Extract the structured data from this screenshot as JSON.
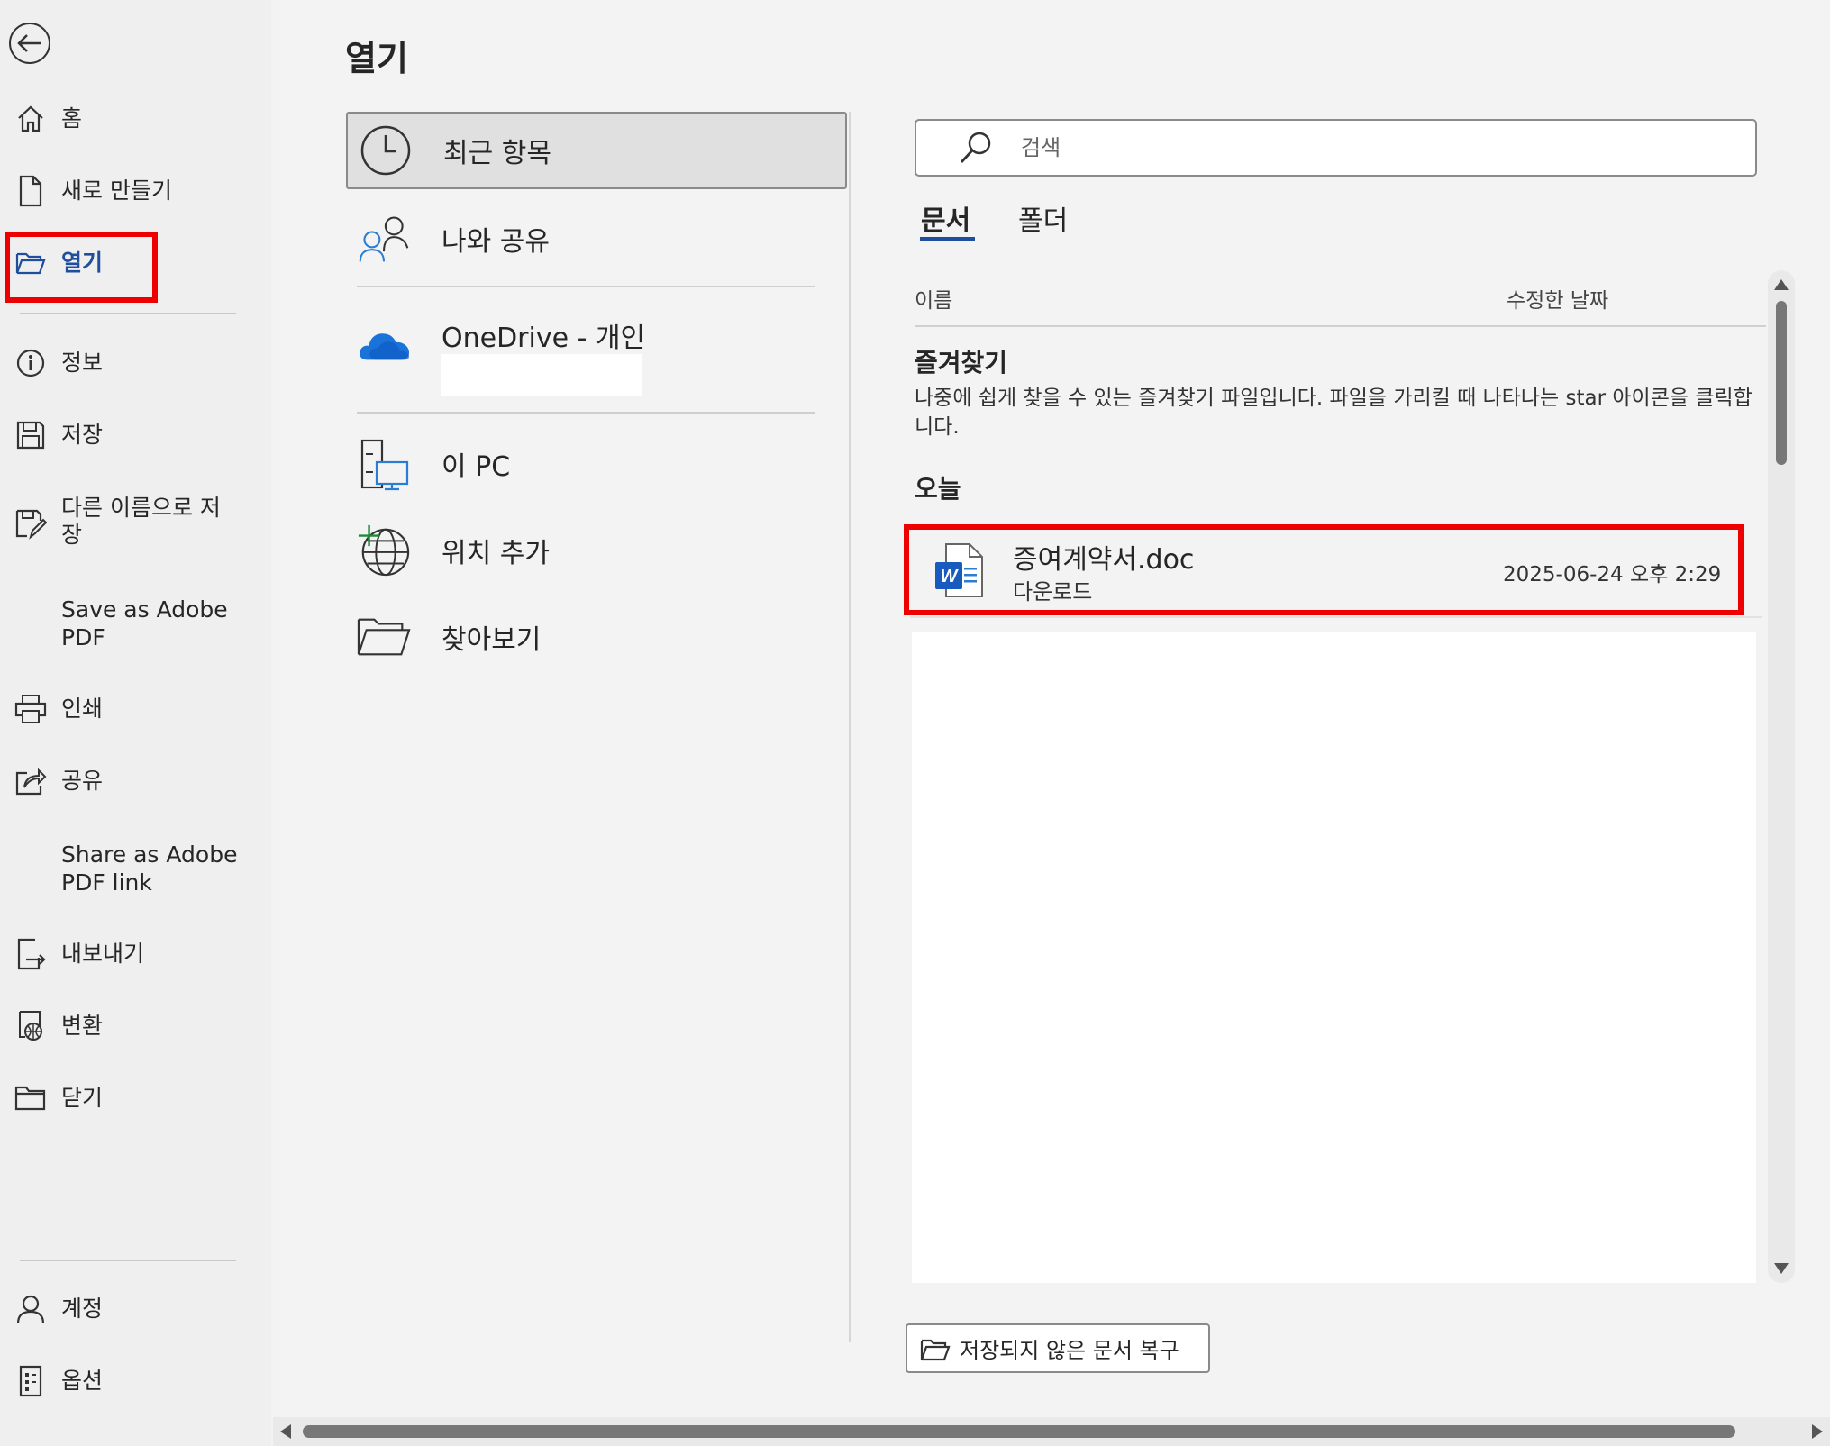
{
  "sidebar": {
    "items": [
      {
        "label": "홈",
        "icon": "home-icon"
      },
      {
        "label": "새로 만들기",
        "icon": "new-document-icon"
      },
      {
        "label": "열기",
        "icon": "open-folder-icon"
      },
      {
        "label": "정보",
        "icon": "info-icon"
      },
      {
        "label": "저장",
        "icon": "save-icon"
      },
      {
        "label": "다른 이름으로 저",
        "label2": "장",
        "icon": "save-as-icon"
      },
      {
        "label": "Save as Adobe",
        "label2": "PDF"
      },
      {
        "label": "인쇄",
        "icon": "print-icon"
      },
      {
        "label": "공유",
        "icon": "share-icon"
      },
      {
        "label": "Share as Adobe",
        "label2": "PDF link"
      },
      {
        "label": "내보내기",
        "icon": "export-icon"
      },
      {
        "label": "변환",
        "icon": "transform-icon"
      },
      {
        "label": "닫기",
        "icon": "close-folder-icon"
      },
      {
        "label": "계정",
        "icon": "account-icon"
      },
      {
        "label": "옵션",
        "icon": "options-icon"
      }
    ],
    "active_index": 2
  },
  "main": {
    "title": "열기",
    "locations": [
      {
        "label": "최근 항목",
        "icon": "clock-icon"
      },
      {
        "label": "나와 공유",
        "icon": "shared-people-icon"
      },
      {
        "label": "OneDrive - 개인",
        "icon": "onedrive-icon"
      },
      {
        "label": "이 PC",
        "icon": "this-pc-icon"
      },
      {
        "label": "위치 추가",
        "icon": "add-place-icon"
      },
      {
        "label": "찾아보기",
        "icon": "browse-folder-icon"
      }
    ],
    "search": {
      "placeholder": "검색"
    },
    "tabs": [
      {
        "label": "문서"
      },
      {
        "label": "폴더"
      }
    ],
    "columns": {
      "name": "이름",
      "modified": "수정한 날짜"
    },
    "favorites": {
      "heading": "즐겨찾기",
      "description": "나중에 쉽게 찾을 수 있는 즐겨찾기 파일입니다. 파일을 가리킬 때 나타나는 star 아이콘을 클릭합니다."
    },
    "today": {
      "heading": "오늘",
      "files": [
        {
          "name": "증여계약서.doc",
          "location": "다운로드",
          "modified": "2025-06-24 오후 2:29",
          "icon": "word-doc-icon"
        }
      ]
    },
    "recover_button": "저장되지 않은 문서 복구"
  },
  "colors": {
    "accent": "#1f4e9c",
    "highlight": "#ee0000"
  }
}
